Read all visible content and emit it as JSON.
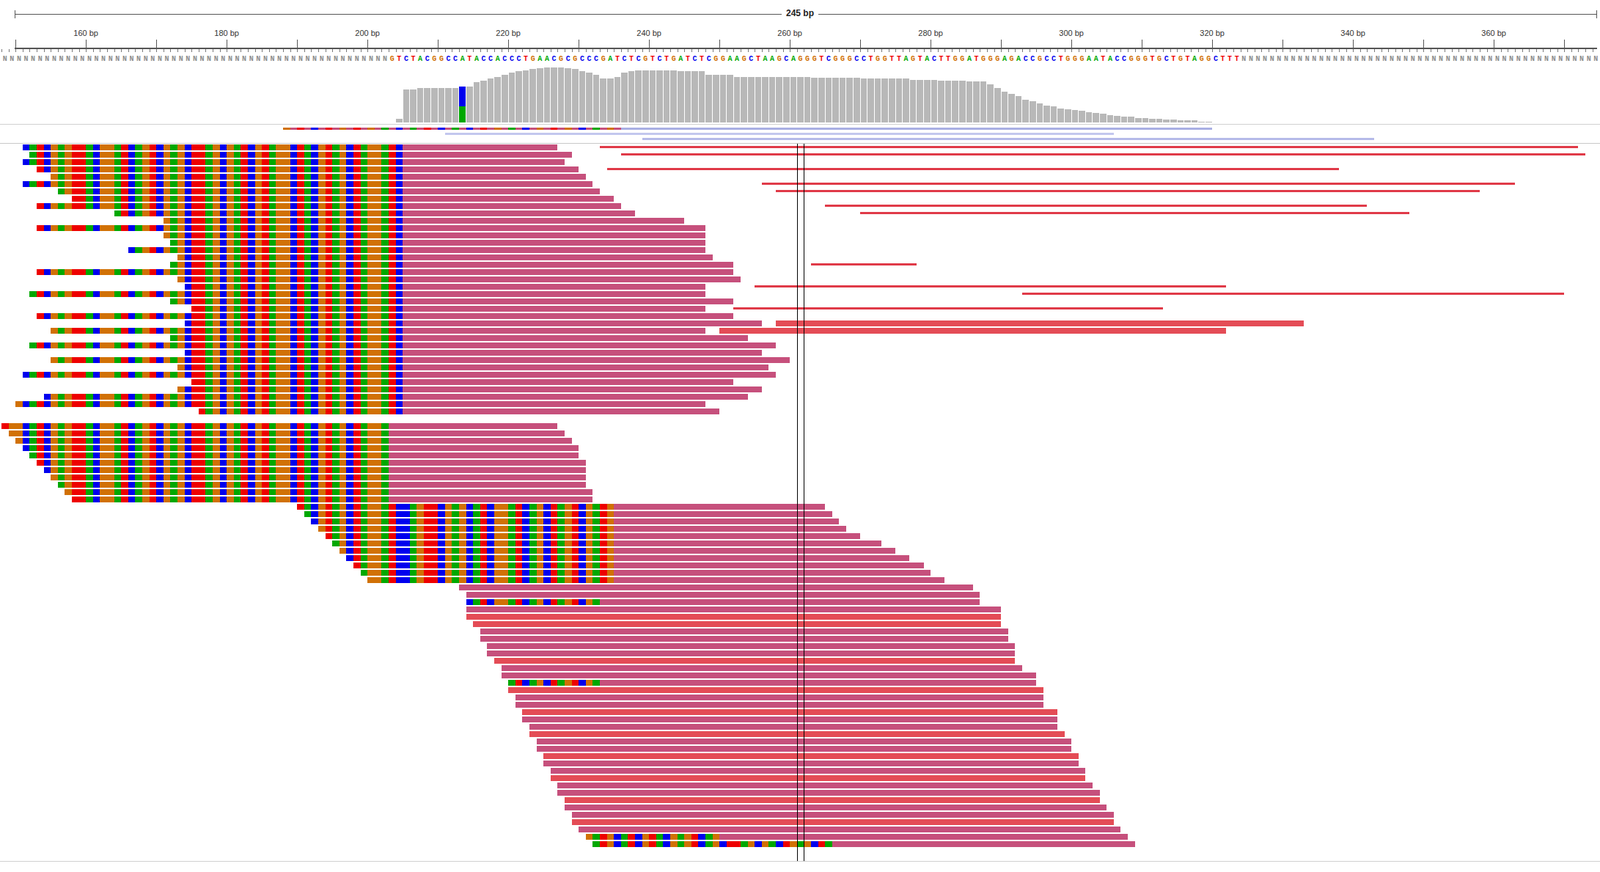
{
  "title": "245 bp",
  "ruler": {
    "ticks": [
      {
        "bp": 160,
        "label": "160 bp"
      },
      {
        "bp": 180,
        "label": "180 bp"
      },
      {
        "bp": 200,
        "label": "200 bp"
      },
      {
        "bp": 220,
        "label": "220 bp"
      },
      {
        "bp": 240,
        "label": "240 bp"
      },
      {
        "bp": 260,
        "label": "260 bp"
      },
      {
        "bp": 280,
        "label": "280 bp"
      },
      {
        "bp": 300,
        "label": "300 bp"
      },
      {
        "bp": 320,
        "label": "320 bp"
      },
      {
        "bp": 340,
        "label": "340 bp"
      },
      {
        "bp": 360,
        "label": "360 bp"
      }
    ]
  },
  "reference": {
    "start": 148,
    "sequence": "NNNNNNNNNNNNNNNNNNNNNNNNNNNNNNNNNNNNNNNNNNNNNNNNNNNNNNNGTCTACGGCCATACCACCCTGAACGCGCCCGATCTCGTCTGATCTCGGAAGCTAAGCAGGGTCGGGCCTGGTTAGTACTTGGATGGGAGACCGCCTGGGAATACCGGGTGCTGTAGGCTTTNNNNNNNNNNNNNNNNNNNNNNNNNNNNNNNNNNNNNNNNNNNNNNNNNNNNNNNNNNNNNN"
  },
  "coverage": {
    "start": 204,
    "values": [
      4,
      35,
      35,
      36,
      36,
      36,
      36,
      36,
      36,
      38,
      38,
      42,
      44,
      46,
      48,
      50,
      52,
      54,
      55,
      56,
      57,
      58,
      58,
      58,
      57,
      56,
      54,
      52,
      50,
      46,
      46,
      48,
      52,
      54,
      55,
      55,
      55,
      55,
      55,
      55,
      54,
      54,
      54,
      54,
      50,
      50,
      50,
      50,
      48,
      48,
      48,
      48,
      48,
      48,
      48,
      48,
      48,
      48,
      48,
      47,
      47,
      47,
      47,
      47,
      47,
      47,
      46,
      46,
      46,
      46,
      46,
      46,
      46,
      45,
      45,
      45,
      45,
      44,
      44,
      44,
      44,
      43,
      43,
      43,
      40,
      36,
      32,
      30,
      28,
      24,
      22,
      20,
      18,
      17,
      15,
      14,
      13,
      12,
      11,
      10,
      9,
      8,
      7,
      6,
      6,
      5,
      5,
      4,
      4,
      3,
      3,
      2,
      2,
      2,
      1,
      1
    ],
    "mismatches": [
      {
        "bp": 213,
        "parts": [
          {
            "base": "A",
            "share": 0.45
          },
          {
            "base": "C",
            "share": 0.55
          }
        ]
      }
    ]
  },
  "summary": [
    {
      "row": 0,
      "start": 188,
      "end": 236,
      "kind": "clip",
      "color": "#c6507c"
    },
    {
      "row": 0,
      "start": 236,
      "end": 320,
      "kind": "plain",
      "color": "#a9afe3"
    },
    {
      "row": 1,
      "start": 211,
      "end": 306,
      "kind": "plain",
      "color": "#c3c7ee"
    },
    {
      "row": 2,
      "start": 239,
      "end": 343,
      "kind": "plain",
      "color": "#b5bae9"
    }
  ],
  "clip_pattern": {
    "start": 148,
    "bases": "TGGCATCGAGTTACGGATCAGTCGAGCTTAGCGATCGTAGGCTACGTAGCTAGGATCCAGTTCGAGCATCGGATCAGCTAGTCGATGCATCGTACGAGTCAGCTTAGCGACTGAGCTA"
  },
  "cursor": {
    "bp": 261
  },
  "reads": [
    [
      0,
      151,
      227,
      151,
      205,
      "#c6507c",
      "full"
    ],
    [
      1,
      152,
      229,
      152,
      205,
      "#c6507c",
      "full"
    ],
    [
      2,
      151,
      228,
      151,
      205,
      "#c6507c",
      "full"
    ],
    [
      3,
      153,
      230,
      153,
      205,
      "#c6507c",
      "full"
    ],
    [
      4,
      155,
      231,
      155,
      205,
      "#c6507c",
      "full"
    ],
    [
      5,
      151,
      232,
      151,
      205,
      "#c6507c",
      "full"
    ],
    [
      6,
      156,
      233,
      156,
      205,
      "#c6507c",
      "full"
    ],
    [
      7,
      158,
      235,
      158,
      205,
      "#c6507c",
      "full"
    ],
    [
      8,
      153,
      236,
      153,
      205,
      "#c6507c",
      "full"
    ],
    [
      9,
      164,
      238,
      164,
      205,
      "#c6507c",
      "full"
    ],
    [
      10,
      171,
      245,
      171,
      205,
      "#c6507c",
      "full"
    ],
    [
      11,
      153,
      248,
      153,
      205,
      "#c6507c",
      "full"
    ],
    [
      12,
      171,
      248,
      171,
      205,
      "#c6507c",
      "full"
    ],
    [
      13,
      172,
      248,
      172,
      205,
      "#c6507c",
      "full"
    ],
    [
      14,
      166,
      248,
      166,
      205,
      "#c6507c",
      "full"
    ],
    [
      15,
      173,
      249,
      173,
      205,
      "#c6507c",
      "full"
    ],
    [
      16,
      172,
      252,
      172,
      205,
      "#c6507c",
      "full"
    ],
    [
      17,
      153,
      252,
      153,
      205,
      "#c6507c",
      "full"
    ],
    [
      18,
      173,
      253,
      173,
      205,
      "#c6507c",
      "full"
    ],
    [
      19,
      174,
      248,
      174,
      205,
      "#c6507c",
      "full"
    ],
    [
      20,
      152,
      248,
      152,
      205,
      "#c6507c",
      "full"
    ],
    [
      21,
      172,
      252,
      172,
      205,
      "#c6507c",
      "full"
    ],
    [
      22,
      175,
      248,
      175,
      205,
      "#c6507c",
      "full"
    ],
    [
      23,
      153,
      252,
      153,
      205,
      "#c6507c",
      "full"
    ],
    [
      24,
      174,
      256,
      174,
      205,
      "#c6507c",
      "full"
    ],
    [
      25,
      155,
      248,
      155,
      205,
      "#c6507c",
      "full"
    ],
    [
      26,
      172,
      254,
      172,
      205,
      "#c6507c",
      "full"
    ],
    [
      27,
      152,
      258,
      152,
      205,
      "#c6507c",
      "full"
    ],
    [
      28,
      174,
      256,
      174,
      205,
      "#c6507c",
      "full"
    ],
    [
      29,
      155,
      260,
      155,
      205,
      "#c6507c",
      "full"
    ],
    [
      30,
      173,
      257,
      173,
      205,
      "#c6507c",
      "full"
    ],
    [
      31,
      151,
      258,
      151,
      205,
      "#c6507c",
      "full"
    ],
    [
      32,
      175,
      252,
      175,
      205,
      "#c6507c",
      "full"
    ],
    [
      33,
      173,
      256,
      173,
      205,
      "#c6507c",
      "full"
    ],
    [
      34,
      154,
      254,
      154,
      205,
      "#c6507c",
      "full"
    ],
    [
      35,
      150,
      248,
      150,
      205,
      "#c6507c",
      "full"
    ],
    [
      36,
      176,
      250,
      176,
      205,
      "#c6507c",
      "full"
    ],
    [
      0,
      233,
      372,
      0,
      0,
      "#e03a48",
      "thin"
    ],
    [
      1,
      236,
      373,
      0,
      0,
      "#e03a48",
      "thin"
    ],
    [
      3,
      234,
      338,
      0,
      0,
      "#e03a48",
      "thin"
    ],
    [
      5,
      256,
      363,
      0,
      0,
      "#e03a48",
      "thin"
    ],
    [
      6,
      258,
      358,
      0,
      0,
      "#e03a48",
      "thin"
    ],
    [
      8,
      265,
      342,
      0,
      0,
      "#e03a48",
      "thin"
    ],
    [
      9,
      270,
      348,
      0,
      0,
      "#e03a48",
      "thin"
    ],
    [
      16,
      263,
      278,
      0,
      0,
      "#e03a48",
      "thin"
    ],
    [
      19,
      255,
      322,
      0,
      0,
      "#e03a48",
      "thin"
    ],
    [
      20,
      293,
      370,
      0,
      0,
      "#e03a48",
      "thin"
    ],
    [
      22,
      252,
      313,
      0,
      0,
      "#e03a48",
      "thin"
    ],
    [
      24,
      258,
      333,
      0,
      0,
      "#e44c56",
      "full"
    ],
    [
      25,
      250,
      322,
      0,
      0,
      "#e44c56",
      "full"
    ],
    [
      38,
      148,
      227,
      148,
      203,
      "#c6507c",
      "full"
    ],
    [
      39,
      149,
      228,
      149,
      203,
      "#c6507c",
      "full"
    ],
    [
      40,
      150,
      229,
      150,
      203,
      "#c6507c",
      "full"
    ],
    [
      41,
      151,
      230,
      151,
      203,
      "#c6507c",
      "full"
    ],
    [
      42,
      152,
      230,
      152,
      203,
      "#c6507c",
      "full"
    ],
    [
      43,
      153,
      231,
      153,
      203,
      "#c6507c",
      "full"
    ],
    [
      44,
      154,
      231,
      154,
      203,
      "#c6507c",
      "full"
    ],
    [
      45,
      155,
      231,
      155,
      203,
      "#c6507c",
      "full"
    ],
    [
      46,
      156,
      231,
      156,
      203,
      "#c6507c",
      "full"
    ],
    [
      47,
      157,
      232,
      157,
      203,
      "#c6507c",
      "full"
    ],
    [
      48,
      158,
      232,
      158,
      203,
      "#c6507c",
      "full"
    ],
    [
      49,
      190,
      265,
      190,
      235,
      "#c6507c",
      "full"
    ],
    [
      50,
      191,
      266,
      191,
      235,
      "#c6507c",
      "full"
    ],
    [
      51,
      192,
      267,
      192,
      235,
      "#c6507c",
      "full"
    ],
    [
      52,
      193,
      268,
      193,
      235,
      "#c6507c",
      "full"
    ],
    [
      53,
      194,
      270,
      194,
      235,
      "#c6507c",
      "full"
    ],
    [
      54,
      195,
      273,
      195,
      235,
      "#c6507c",
      "full"
    ],
    [
      55,
      196,
      275,
      196,
      235,
      "#c6507c",
      "full"
    ],
    [
      56,
      197,
      277,
      197,
      235,
      "#c6507c",
      "full"
    ],
    [
      57,
      198,
      279,
      198,
      235,
      "#c6507c",
      "full"
    ],
    [
      58,
      199,
      280,
      199,
      235,
      "#c6507c",
      "full"
    ],
    [
      59,
      200,
      282,
      200,
      235,
      "#c6507c",
      "full"
    ],
    [
      60,
      213,
      286,
      0,
      0,
      "#c6507c",
      "full"
    ],
    [
      61,
      214,
      287,
      0,
      0,
      "#c6507c",
      "full"
    ],
    [
      62,
      214,
      287,
      214,
      233,
      "#c6507c",
      "full"
    ],
    [
      63,
      214,
      290,
      0,
      0,
      "#c6507c",
      "full"
    ],
    [
      64,
      214,
      290,
      0,
      0,
      "#e44c56",
      "full"
    ],
    [
      65,
      215,
      290,
      0,
      0,
      "#e44c56",
      "full"
    ],
    [
      66,
      216,
      291,
      0,
      0,
      "#c6507c",
      "full"
    ],
    [
      67,
      216,
      291,
      0,
      0,
      "#c6507c",
      "full"
    ],
    [
      68,
      217,
      292,
      0,
      0,
      "#c6507c",
      "full"
    ],
    [
      69,
      217,
      292,
      0,
      0,
      "#c6507c",
      "full"
    ],
    [
      70,
      218,
      292,
      0,
      0,
      "#e44c56",
      "full"
    ],
    [
      71,
      219,
      293,
      0,
      0,
      "#c6507c",
      "full"
    ],
    [
      72,
      219,
      295,
      0,
      0,
      "#c6507c",
      "full"
    ],
    [
      73,
      220,
      295,
      220,
      233,
      "#c6507c",
      "full"
    ],
    [
      74,
      220,
      296,
      0,
      0,
      "#e44c56",
      "full"
    ],
    [
      75,
      221,
      296,
      0,
      0,
      "#c6507c",
      "full"
    ],
    [
      76,
      221,
      296,
      0,
      0,
      "#c6507c",
      "full"
    ],
    [
      77,
      222,
      298,
      0,
      0,
      "#e44c56",
      "full"
    ],
    [
      78,
      222,
      298,
      0,
      0,
      "#c6507c",
      "full"
    ],
    [
      79,
      223,
      298,
      0,
      0,
      "#c6507c",
      "full"
    ],
    [
      80,
      223,
      299,
      0,
      0,
      "#e44c56",
      "full"
    ],
    [
      81,
      224,
      300,
      0,
      0,
      "#c6507c",
      "full"
    ],
    [
      82,
      224,
      300,
      0,
      0,
      "#c6507c",
      "full"
    ],
    [
      83,
      225,
      301,
      0,
      0,
      "#e44c56",
      "full"
    ],
    [
      84,
      225,
      301,
      0,
      0,
      "#c6507c",
      "full"
    ],
    [
      85,
      226,
      302,
      0,
      0,
      "#c6507c",
      "full"
    ],
    [
      86,
      226,
      302,
      0,
      0,
      "#e44c56",
      "full"
    ],
    [
      87,
      227,
      303,
      0,
      0,
      "#c6507c",
      "full"
    ],
    [
      88,
      227,
      304,
      0,
      0,
      "#c6507c",
      "full"
    ],
    [
      89,
      228,
      304,
      0,
      0,
      "#e44c56",
      "full"
    ],
    [
      90,
      228,
      305,
      0,
      0,
      "#c6507c",
      "full"
    ],
    [
      91,
      229,
      306,
      0,
      0,
      "#c6507c",
      "full"
    ],
    [
      92,
      229,
      306,
      0,
      0,
      "#e44c56",
      "full"
    ],
    [
      93,
      230,
      307,
      0,
      0,
      "#c6507c",
      "full"
    ],
    [
      94,
      231,
      308,
      231,
      250,
      "#c6507c",
      "full"
    ],
    [
      95,
      232,
      309,
      232,
      266,
      "#c6507c",
      "full"
    ]
  ]
}
